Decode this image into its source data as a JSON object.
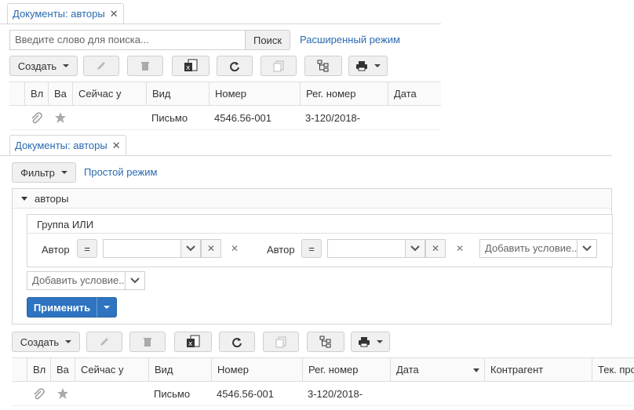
{
  "top": {
    "tab_title": "Документы: авторы",
    "tab_close": "✕",
    "search_placeholder": "Введите слово для поиска...",
    "search_button": "Поиск",
    "advanced_link": "Расширенный режим",
    "create_label": "Создать",
    "columns": [
      "Вл",
      "Ва",
      "Сейчас у",
      "Вид",
      "Номер",
      "Рег. номер",
      "Дата"
    ],
    "row": {
      "vid": "Письмо",
      "nomer": "4546.56-001",
      "reg": "3-120/2018-"
    }
  },
  "bottom": {
    "tab_title": "Документы: авторы",
    "tab_close": "✕",
    "filter_label": "Фильтр",
    "simple_link": "Простой режим",
    "section_label": "авторы",
    "group_label": "Группа ИЛИ",
    "cond1": {
      "field": "Автор",
      "op": "=",
      "value": ""
    },
    "cond2": {
      "field": "Автор",
      "op": "=",
      "value": ""
    },
    "add_condition": "Добавить условие..",
    "add_condition_outer": "Добавить условие..",
    "apply_label": "Применить",
    "create_label": "Создать",
    "columns": [
      "Вл",
      "Ва",
      "Сейчас у",
      "Вид",
      "Номер",
      "Рег. номер",
      "Дата",
      "Контрагент",
      "Тек. про"
    ],
    "row": {
      "vid": "Письмо",
      "nomer": "4546.56-001",
      "reg": "3-120/2018-"
    }
  },
  "icons": {
    "edit": "pencil-icon",
    "delete": "trash-icon",
    "excel": "excel-export-icon",
    "refresh": "refresh-icon",
    "copy": "copy-document-icon",
    "tree": "tree-structure-icon",
    "print": "printer-icon",
    "attachment": "paperclip-icon",
    "favorite": "star-icon"
  }
}
